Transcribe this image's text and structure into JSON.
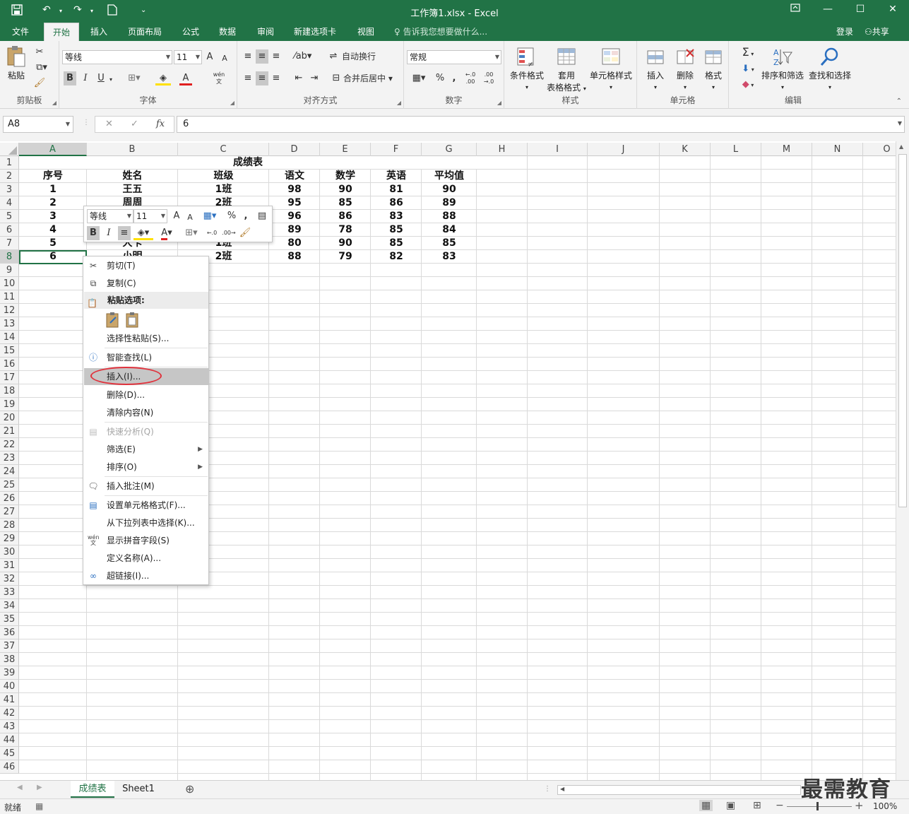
{
  "titlebar": {
    "title": "工作簿1.xlsx  -  Excel",
    "save_icon": "save-icon",
    "undo_icon": "undo-icon",
    "redo_icon": "redo-icon",
    "new_icon": "new-file-icon",
    "customize_icon": "customize-qat-icon",
    "restore_icon": "ribbon-display-icon",
    "min": "—",
    "max": "☐",
    "close": "✕"
  },
  "tabs": [
    "文件",
    "开始",
    "插入",
    "页面布局",
    "公式",
    "数据",
    "审阅",
    "新建选项卡",
    "视图"
  ],
  "active_tab": "开始",
  "tellme": "告诉我您想要做什么...",
  "login": "登录",
  "share": "共享",
  "ribbon": {
    "clipboard": {
      "paste": "粘贴",
      "label": "剪贴板"
    },
    "font": {
      "font_name": "等线",
      "font_size": "11",
      "bold": "B",
      "italic": "I",
      "underline": "U",
      "label": "字体",
      "grow": "A",
      "shrink": "A",
      "font_color_letter": "A",
      "phonetic": "wén"
    },
    "alignment": {
      "wrap": "自动换行",
      "merge": "合并后居中",
      "label": "对齐方式"
    },
    "number": {
      "format": "常规",
      "percent": "%",
      "comma": ",",
      "label": "数字",
      "inc_dec": "←.0 .00",
      "dec_dec": ".00 →.0"
    },
    "styles": {
      "cond": "条件格式",
      "table1": "套用",
      "table2": "表格格式",
      "cell": "单元格样式",
      "label": "样式"
    },
    "cells": {
      "insert": "插入",
      "delete": "删除",
      "format": "格式",
      "label": "单元格"
    },
    "editing": {
      "sort": "排序和筛选",
      "find": "查找和选择",
      "label": "编辑",
      "sum": "Σ"
    }
  },
  "formula": {
    "namebox": "A8",
    "cancel": "✕",
    "enter": "✓",
    "fx": "fx",
    "value": "6"
  },
  "columns": [
    "A",
    "B",
    "C",
    "D",
    "E",
    "F",
    "G",
    "H",
    "I",
    "J",
    "K",
    "L",
    "M",
    "N",
    "O"
  ],
  "rows": [
    "1",
    "2",
    "3",
    "4",
    "5",
    "6",
    "7",
    "8",
    "9",
    "10",
    "11",
    "12",
    "13",
    "14",
    "15",
    "16",
    "17",
    "18",
    "19",
    "20",
    "21",
    "22",
    "23",
    "24",
    "25",
    "26",
    "27",
    "28",
    "29",
    "30",
    "31",
    "32",
    "33",
    "34",
    "35",
    "36",
    "37",
    "38",
    "39",
    "40",
    "41",
    "42",
    "43",
    "44",
    "45",
    "46"
  ],
  "sheet": {
    "title": "成绩表",
    "headers": [
      "序号",
      "姓名",
      "班级",
      "语文",
      "数学",
      "英语",
      "平均值"
    ],
    "rows": [
      [
        "1",
        "王五",
        "1班",
        "98",
        "90",
        "81",
        "90"
      ],
      [
        "2",
        "周周",
        "2班",
        "95",
        "85",
        "86",
        "89"
      ],
      [
        "3",
        "",
        "",
        "96",
        "86",
        "83",
        "88"
      ],
      [
        "4",
        "",
        "",
        "89",
        "78",
        "85",
        "84"
      ],
      [
        "5",
        "大卡",
        "1班",
        "80",
        "90",
        "85",
        "85"
      ],
      [
        "6",
        "小明",
        "2班",
        "88",
        "79",
        "82",
        "83"
      ]
    ]
  },
  "minitoolbar": {
    "font": "等线",
    "size": "11",
    "grow": "A",
    "shrink": "A",
    "percent": "%",
    "comma": ",",
    "bold": "B",
    "italic": "I",
    "font_color_letter": "A",
    "inc_dec": "←.0",
    "dec_dec": ".00→"
  },
  "context_menu": {
    "cut": "剪切(T)",
    "copy": "复制(C)",
    "paste_header": "粘贴选项:",
    "paste_special": "选择性粘贴(S)...",
    "smart_lookup": "智能查找(L)",
    "insert": "插入(I)...",
    "delete": "删除(D)...",
    "clear": "清除内容(N)",
    "quick_analysis": "快速分析(Q)",
    "filter": "筛选(E)",
    "sort": "排序(O)",
    "insert_comment": "插入批注(M)",
    "format_cells": "设置单元格格式(F)...",
    "pick_list": "从下拉列表中选择(K)...",
    "phonetic": "显示拼音字段(S)",
    "define_name": "定义名称(A)...",
    "hyperlink": "超链接(I)..."
  },
  "sheet_tabs": [
    "成绩表",
    "Sheet1"
  ],
  "active_sheet": "成绩表",
  "add_sheet": "⊕",
  "status": {
    "ready": "就绪",
    "zoom": "100%"
  },
  "watermark": "最需教育",
  "colors": {
    "accent": "#217346",
    "highlight_oval": "#e0323c"
  }
}
